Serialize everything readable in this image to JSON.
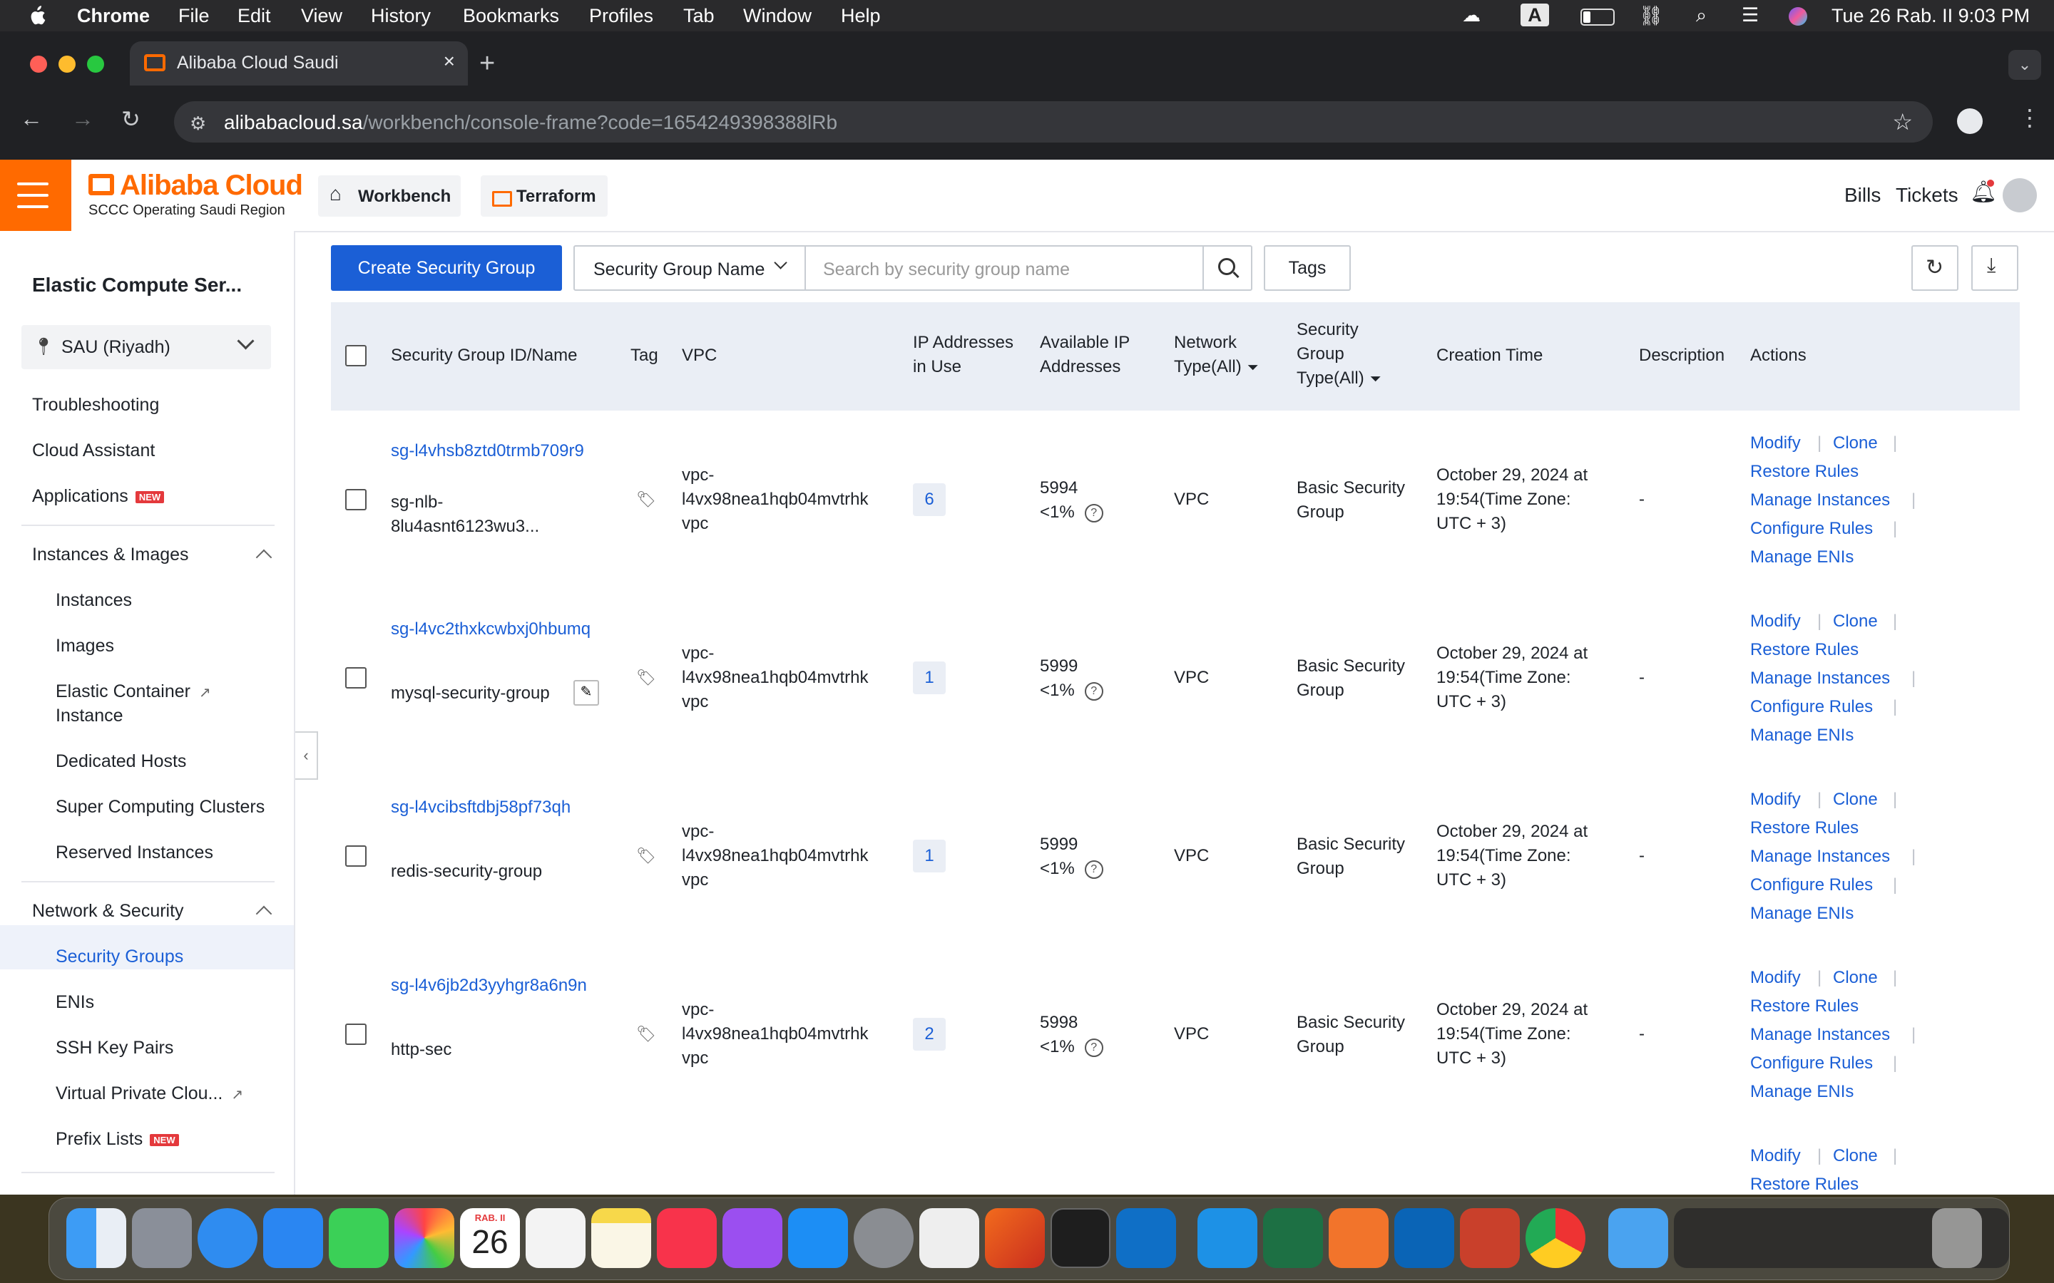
{
  "menubar": {
    "app": "Chrome",
    "items": [
      "File",
      "Edit",
      "View",
      "History",
      "Bookmarks",
      "Profiles",
      "Tab",
      "Window",
      "Help"
    ],
    "input_indicator": "A",
    "datetime": "Tue 26 Rab. II  9:03 PM"
  },
  "browser": {
    "tab_title": "Alibaba Cloud Saudi",
    "url_host": "alibabacloud.sa",
    "url_path": "/workbench/console-frame?code=1654249398388lRb"
  },
  "header": {
    "logo": "Alibaba Cloud",
    "logo_sub": "SCCC Operating Saudi Region",
    "workbench": "Workbench",
    "terraform": "Terraform",
    "bills": "Bills",
    "tickets": "Tickets"
  },
  "sidebar": {
    "title": "Elastic Compute Ser...",
    "region": "SAU (Riyadh)",
    "troubleshooting": "Troubleshooting",
    "cloud_assistant": "Cloud Assistant",
    "applications": "Applications",
    "new_badge": "NEW",
    "group_instances": "Instances & Images",
    "instances": "Instances",
    "images": "Images",
    "eci_line1": "Elastic Container",
    "eci_line2": "Instance",
    "dedicated_hosts": "Dedicated Hosts",
    "super_computing": "Super Computing Clusters",
    "reserved": "Reserved Instances",
    "group_network": "Network & Security",
    "security_groups": "Security Groups",
    "enis": "ENIs",
    "ssh_key_pairs": "SSH Key Pairs",
    "vpc": "Virtual Private Clou...",
    "prefix_lists": "Prefix Lists"
  },
  "toolbar": {
    "create": "Create Security Group",
    "filter": "Security Group Name",
    "search_placeholder": "Search by security group name",
    "tags": "Tags"
  },
  "table": {
    "headers": {
      "id_name": "Security Group ID/Name",
      "tag": "Tag",
      "vpc": "VPC",
      "ip_in_use_1": "IP Addresses",
      "ip_in_use_2": "in Use",
      "avail_1": "Available IP",
      "avail_2": "Addresses",
      "net_1": "Network",
      "net_2": "Type(All)",
      "sgtype_1": "Security",
      "sgtype_2": "Group",
      "sgtype_3": "Type(All)",
      "created": "Creation Time",
      "desc": "Description",
      "actions": "Actions"
    },
    "actions": {
      "modify": "Modify",
      "clone": "Clone",
      "restore": "Restore Rules",
      "manage_instances": "Manage Instances",
      "configure": "Configure Rules",
      "manage_enis": "Manage ENIs"
    },
    "rows": [
      {
        "id": "sg-l4vhsb8ztd0trmb709r9",
        "name1": "sg-nlb-",
        "name2": "8lu4asnt6123wu3...",
        "vpc1": "vpc-",
        "vpc2": "l4vx98nea1hqb04mvtrhk",
        "vpc3": "vpc",
        "ips": "6",
        "avail": "5994",
        "pct": "<1%",
        "net": "VPC",
        "type1": "Basic Security",
        "type2": "Group",
        "time1": "October 29, 2024 at",
        "time2": "19:54(Time Zone:",
        "time3": "UTC + 3)",
        "desc": "-"
      },
      {
        "id": "sg-l4vc2thxkcwbxj0hbumq",
        "name1": "mysql-security-group",
        "name2": "",
        "vpc1": "vpc-",
        "vpc2": "l4vx98nea1hqb04mvtrhk",
        "vpc3": "vpc",
        "ips": "1",
        "avail": "5999",
        "pct": "<1%",
        "net": "VPC",
        "type1": "Basic Security",
        "type2": "Group",
        "time1": "October 29, 2024 at",
        "time2": "19:54(Time Zone:",
        "time3": "UTC + 3)",
        "desc": "-"
      },
      {
        "id": "sg-l4vcibsftdbj58pf73qh",
        "name1": "redis-security-group",
        "name2": "",
        "vpc1": "vpc-",
        "vpc2": "l4vx98nea1hqb04mvtrhk",
        "vpc3": "vpc",
        "ips": "1",
        "avail": "5999",
        "pct": "<1%",
        "net": "VPC",
        "type1": "Basic Security",
        "type2": "Group",
        "time1": "October 29, 2024 at",
        "time2": "19:54(Time Zone:",
        "time3": "UTC + 3)",
        "desc": "-"
      },
      {
        "id": "sg-l4v6jb2d3yyhgr8a6n9n",
        "name1": "http-sec",
        "name2": "",
        "vpc1": "vpc-",
        "vpc2": "l4vx98nea1hqb04mvtrhk",
        "vpc3": "vpc",
        "ips": "2",
        "avail": "5998",
        "pct": "<1%",
        "net": "VPC",
        "type1": "Basic Security",
        "type2": "Group",
        "time1": "October 29, 2024 at",
        "time2": "19:54(Time Zone:",
        "time3": "UTC + 3)",
        "desc": "-"
      }
    ]
  },
  "dock": {
    "calendar_month": "RAB. II",
    "calendar_day": "26"
  },
  "colors": {
    "brand": "#ff6a00",
    "link": "#1b5fd6",
    "header_bg": "#eaeef5"
  }
}
